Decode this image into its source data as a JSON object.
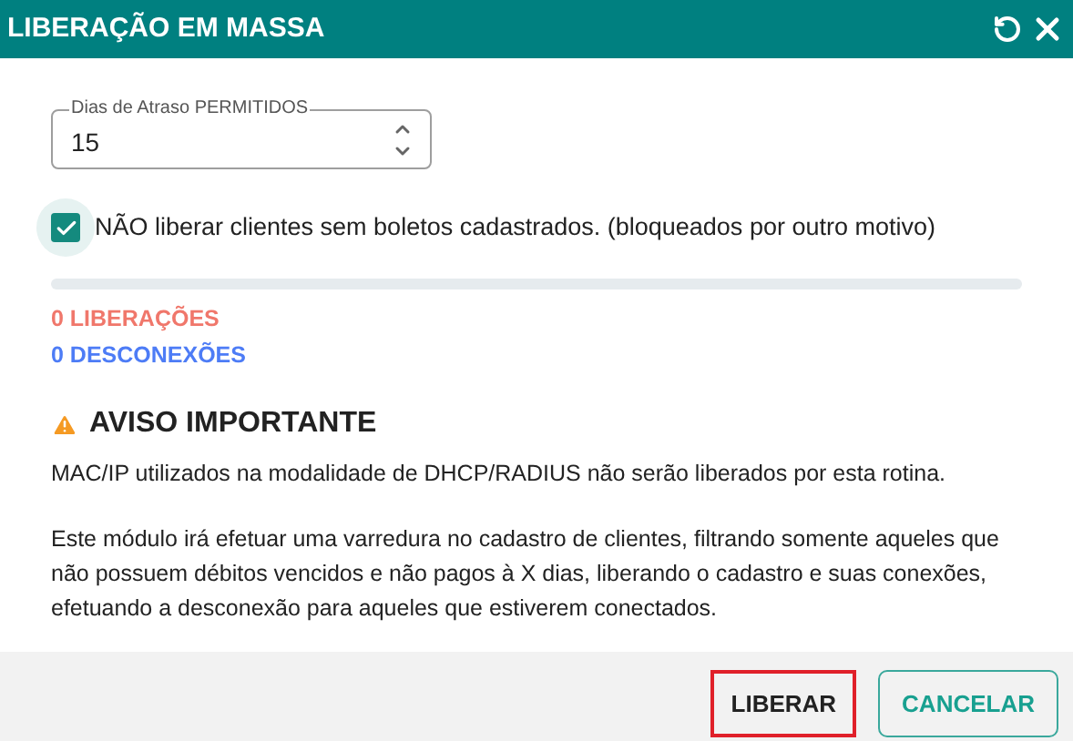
{
  "window": {
    "title": "LIBERAÇÃO EM MASSA"
  },
  "days_field": {
    "label": "Dias de Atraso PERMITIDOS",
    "value": "15"
  },
  "option": {
    "label": "NÃO liberar clientes sem boletos cadastrados. (bloqueados por outro motivo)",
    "checked": true
  },
  "counts": [
    {
      "text": "0 LIBERAÇÕES",
      "color": "#f0776b"
    },
    {
      "text": "0 DESCONEXÕES",
      "color": "#4d7cf6"
    }
  ],
  "warning": {
    "title": "AVISO IMPORTANTE",
    "paragraphs": [
      "MAC/IP utilizados na modalidade de DHCP/RADIUS não serão liberados por esta rotina.",
      "Este módulo irá efetuar uma varredura no cadastro de clientes, filtrando somente aqueles que não possuem débitos vencidos e não pagos à X dias, liberando o cadastro e suas conexões, efetuando a desconexão para aqueles que estiverem conectados."
    ]
  },
  "buttons": [
    {
      "label": "LIBERAR",
      "kind": "highlighted"
    },
    {
      "label": "CANCELAR",
      "kind": "outlined"
    }
  ]
}
